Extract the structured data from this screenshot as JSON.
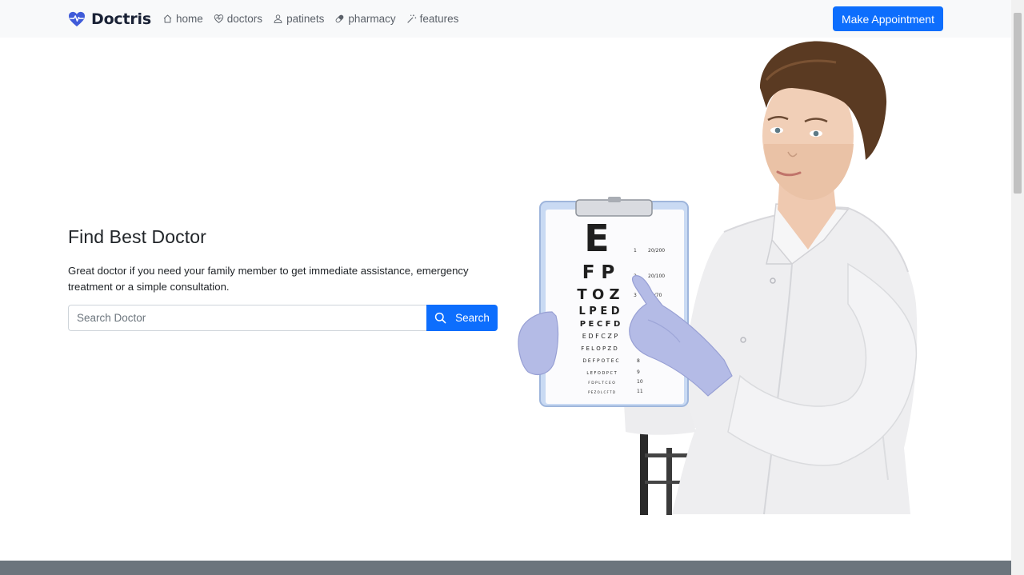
{
  "brand": {
    "name": "Doctris",
    "accent": "#3f5bd9"
  },
  "nav": {
    "items": [
      {
        "label": "home",
        "icon": "home-icon"
      },
      {
        "label": "doctors",
        "icon": "heart-pulse-icon"
      },
      {
        "label": "patinets",
        "icon": "user-icon"
      },
      {
        "label": "pharmacy",
        "icon": "capsule-icon"
      },
      {
        "label": "features",
        "icon": "magic-wand-icon"
      }
    ],
    "cta_label": "Make Appointment"
  },
  "hero": {
    "title": "Find Best Doctor",
    "text": "Great doctor if you need your family member to get immediate assistance, emergency treatment or a simple consultation.",
    "search": {
      "placeholder": "Search Doctor",
      "button_label": "Search"
    }
  },
  "eye_chart": {
    "rows": [
      "E",
      "F P",
      "T O Z",
      "L P E D",
      "P E C F D",
      "E D F C Z P",
      "F E L O P Z D",
      "D E F P O T E C",
      "L E F O D P C T",
      "F D P L T C E O",
      "P E Z O L C F T D"
    ],
    "ratios": [
      "20/200",
      "20/100",
      "20/70"
    ],
    "row_numbers": [
      "1",
      "2",
      "3",
      "8",
      "9",
      "10",
      "11"
    ]
  },
  "colors": {
    "primary": "#0d6efd",
    "navbar_bg": "#f8f9fa",
    "footer": "#6c757d"
  }
}
